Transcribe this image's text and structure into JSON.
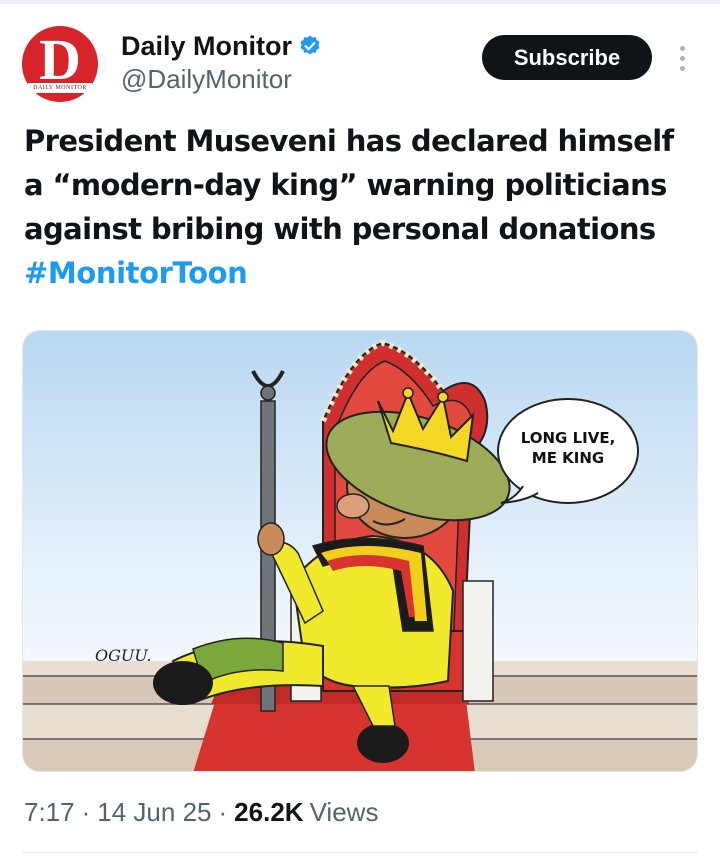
{
  "account": {
    "name": "Daily Monitor",
    "handle": "@DailyMonitor",
    "avatar_letter": "D",
    "avatar_caption": "DAILY MONITOR",
    "verified_icon": "verified-badge-icon",
    "verified_color": "#1d9bf0"
  },
  "actions": {
    "subscribe_label": "Subscribe",
    "more_icon": "more-options-icon"
  },
  "tweet": {
    "text_lines": [
      "President Museveni has declared himself",
      "a “modern-day king” warning politicians",
      "against bribing with personal donations"
    ],
    "hashtag": "#MonitorToon"
  },
  "cartoon": {
    "speech_line1": "LONG LIVE,",
    "speech_line2": "ME KING",
    "signature": "OGUU."
  },
  "meta": {
    "time": "7:17",
    "date": "14 Jun 25",
    "views_count": "26.2K",
    "views_label": "Views"
  },
  "colors": {
    "link_blue": "#1d9bf0",
    "text_primary": "#0f1419",
    "text_secondary": "#536471",
    "brand_red": "#d7242b"
  }
}
